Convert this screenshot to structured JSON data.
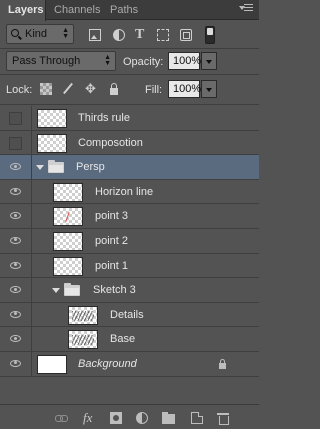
{
  "tabs": [
    {
      "label": "Layers",
      "active": true
    },
    {
      "label": "Channels",
      "active": false
    },
    {
      "label": "Paths",
      "active": false
    }
  ],
  "filter": {
    "kind_label": "Kind",
    "icons": [
      "image-filter-icon",
      "adjustment-filter-icon",
      "type-filter-icon",
      "shape-filter-icon",
      "smart-object-filter-icon"
    ]
  },
  "blend": {
    "mode": "Pass Through",
    "opacity_label": "Opacity:",
    "opacity_value": "100%"
  },
  "lock": {
    "label": "Lock:",
    "fill_label": "Fill:",
    "fill_value": "100%"
  },
  "layers": [
    {
      "name": "Thirds rule",
      "visible": false,
      "type": "layer",
      "thumb": "transparent"
    },
    {
      "name": "Composotion",
      "visible": false,
      "type": "layer",
      "thumb": "transparent"
    },
    {
      "name": "Persp",
      "visible": true,
      "type": "group",
      "selected": true,
      "expanded": true
    },
    {
      "name": "Horizon line",
      "visible": true,
      "type": "layer",
      "thumb": "transparent"
    },
    {
      "name": "point 3",
      "visible": true,
      "type": "layer",
      "thumb": "transparent-mark"
    },
    {
      "name": "point 2",
      "visible": true,
      "type": "layer",
      "thumb": "transparent"
    },
    {
      "name": "point 1",
      "visible": true,
      "type": "layer",
      "thumb": "transparent"
    },
    {
      "name": "Sketch 3",
      "visible": true,
      "type": "group",
      "expanded": true
    },
    {
      "name": "Details",
      "visible": true,
      "type": "layer",
      "thumb": "sketch"
    },
    {
      "name": "Base",
      "visible": true,
      "type": "layer",
      "thumb": "sketch"
    },
    {
      "name": "Background",
      "visible": true,
      "type": "background",
      "thumb": "white",
      "locked": true
    }
  ],
  "bottom_icons": [
    "link-layers-icon",
    "fx-icon",
    "layer-mask-icon",
    "adjustment-layer-icon",
    "new-group-icon",
    "new-layer-icon",
    "delete-layer-icon"
  ],
  "colors": {
    "panel": "#535353",
    "selected": "#5a6a7f",
    "tabbar": "#3c3c3c"
  }
}
